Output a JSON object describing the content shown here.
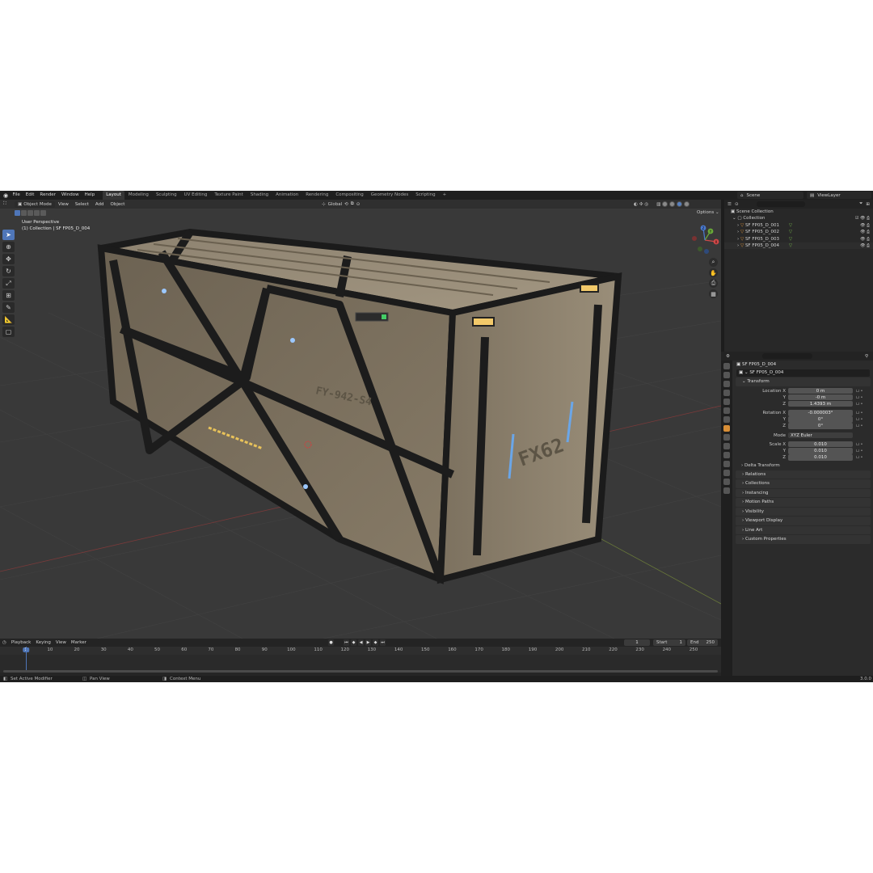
{
  "app": {
    "menu": [
      "File",
      "Edit",
      "Render",
      "Window",
      "Help"
    ],
    "workspaces": [
      "Layout",
      "Modeling",
      "Sculpting",
      "UV Editing",
      "Texture Paint",
      "Shading",
      "Animation",
      "Rendering",
      "Compositing",
      "Geometry Nodes",
      "Scripting",
      "+"
    ],
    "active_workspace": "Layout",
    "scene": "Scene",
    "view_layer": "ViewLayer"
  },
  "viewport": {
    "mode": "Object Mode",
    "menus": [
      "View",
      "Select",
      "Add",
      "Object"
    ],
    "orientation": "Global",
    "options": "Options",
    "info_line1": "User Perspective",
    "info_line2": "(1) Collection | SF FP05_D_004",
    "model_text_side": "FY-942-S4",
    "model_text_front": "FX62",
    "gizmo_axes": {
      "x": "X",
      "y": "Y",
      "z": "Z"
    }
  },
  "timeline": {
    "menus": [
      "Playback",
      "Keying",
      "View",
      "Marker"
    ],
    "current_frame": "1",
    "start_label": "Start",
    "start": "1",
    "end_label": "End",
    "end": "250",
    "ticks": [
      "1",
      "10",
      "20",
      "30",
      "40",
      "50",
      "60",
      "70",
      "80",
      "90",
      "100",
      "110",
      "120",
      "130",
      "140",
      "150",
      "160",
      "170",
      "180",
      "190",
      "200",
      "210",
      "220",
      "230",
      "240",
      "250"
    ]
  },
  "status": {
    "left": "Set Active Modifier",
    "middle": "Pan View",
    "right": "Context Menu",
    "version": "3.0.0"
  },
  "outliner": {
    "root": "Scene Collection",
    "collection": "Collection",
    "items": [
      "SF FP05_D_001",
      "SF FP05_D_002",
      "SF FP05_D_003",
      "SF FP05_D_004"
    ]
  },
  "properties": {
    "object": "SF FP05_D_004",
    "object_field": "SF FP05_D_004",
    "transform_label": "Transform",
    "location": {
      "label": "Location X",
      "x": "0 m",
      "y": "-0 m",
      "z": "1.4393 m"
    },
    "rotation": {
      "label": "Rotation X",
      "x": "-0.000003°",
      "y": "0°",
      "z": "0°"
    },
    "mode_label": "Mode",
    "mode_value": "XYZ Euler",
    "scale": {
      "label": "Scale X",
      "x": "0.010",
      "y": "0.010",
      "z": "0.010"
    },
    "axis_y": "Y",
    "axis_z": "Z",
    "delta_transform": "Delta Transform",
    "panels": [
      "Relations",
      "Collections",
      "Instancing",
      "Motion Paths",
      "Visibility",
      "Viewport Display",
      "Line Art",
      "Custom Properties"
    ]
  },
  "colors": {
    "accent": "#4f76b8",
    "object_orange": "#d88e36",
    "mesh_green": "#73b24a",
    "viewport_bg": "#393939"
  }
}
